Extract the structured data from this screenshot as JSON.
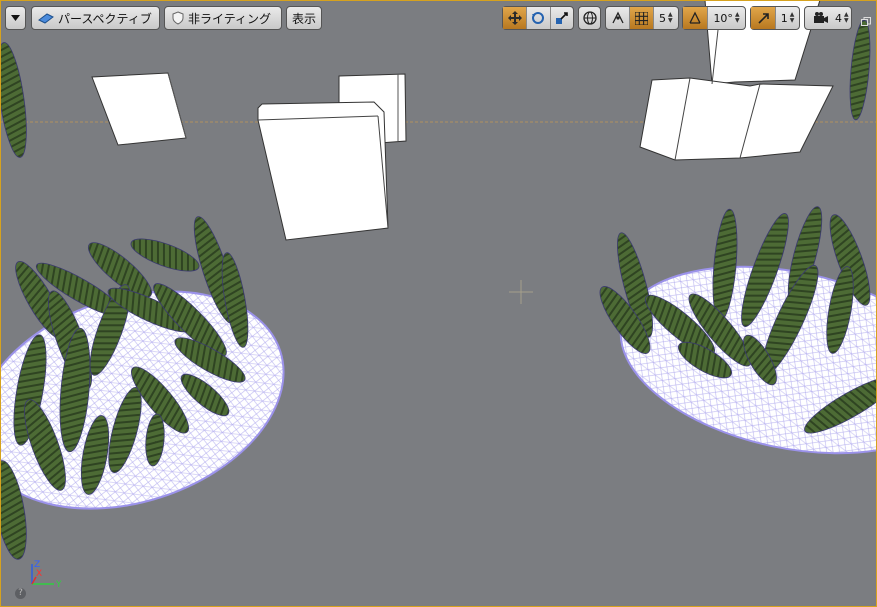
{
  "toolbar": {
    "view_mode_label": "パースペクティブ",
    "lighting_label": "非ライティング",
    "show_label": "表示",
    "grid_snap_value": "5",
    "rotation_snap_value": "10°",
    "scale_snap_value": "1",
    "camera_speed_value": "4"
  },
  "axis": {
    "z": "Z",
    "x": "X",
    "y": "Y"
  },
  "help": "?",
  "colors": {
    "accent": "#e0a04a",
    "viewport_bg": "#7b7d81",
    "border": "#d6a21e"
  }
}
